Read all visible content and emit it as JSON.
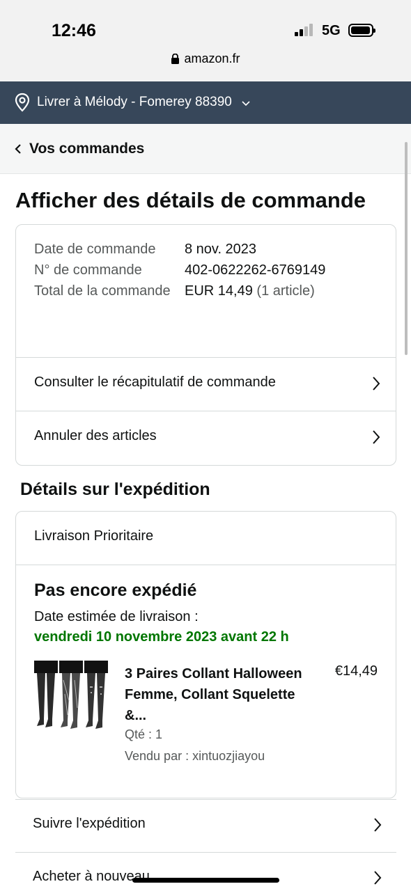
{
  "status_bar": {
    "time": "12:46",
    "network": "5G"
  },
  "browser": {
    "domain": "amazon.fr"
  },
  "delivery_bar": {
    "text": "Livrer à Mélody - Fomerey 88390"
  },
  "nav": {
    "back_label": "Vos commandes"
  },
  "page": {
    "title": "Afficher des détails de commande"
  },
  "order": {
    "date_label": "Date de commande",
    "date_value": "8 nov. 2023",
    "number_label": "N° de commande",
    "number_value": "402-0622262-6769149",
    "total_label": "Total de la commande",
    "total_value": "EUR 14,49",
    "total_count": "(1 article)",
    "links": [
      {
        "label": "Consulter le récapitulatif de commande"
      },
      {
        "label": "Annuler des articles"
      }
    ]
  },
  "shipment": {
    "section_title": "Détails sur l'expédition",
    "type": "Livraison Prioritaire",
    "status": "Pas encore expédié",
    "estimate_label": "Date estimée de livraison :",
    "estimate_date": "vendredi 10 novembre 2023 avant 22 h",
    "item": {
      "title": "3 Paires Collant Halloween Femme, Collant Squelette &...",
      "price": "€14,49",
      "quantity": "Qté : 1",
      "seller": "Vendu par : xintuozjiayou"
    }
  },
  "actions": [
    {
      "label": "Suivre l'expédition"
    },
    {
      "label": "Acheter à nouveau"
    }
  ],
  "colors": {
    "delivery_bar_bg": "#37475a",
    "estimate_green": "#007600",
    "border": "#d5d9d9"
  }
}
